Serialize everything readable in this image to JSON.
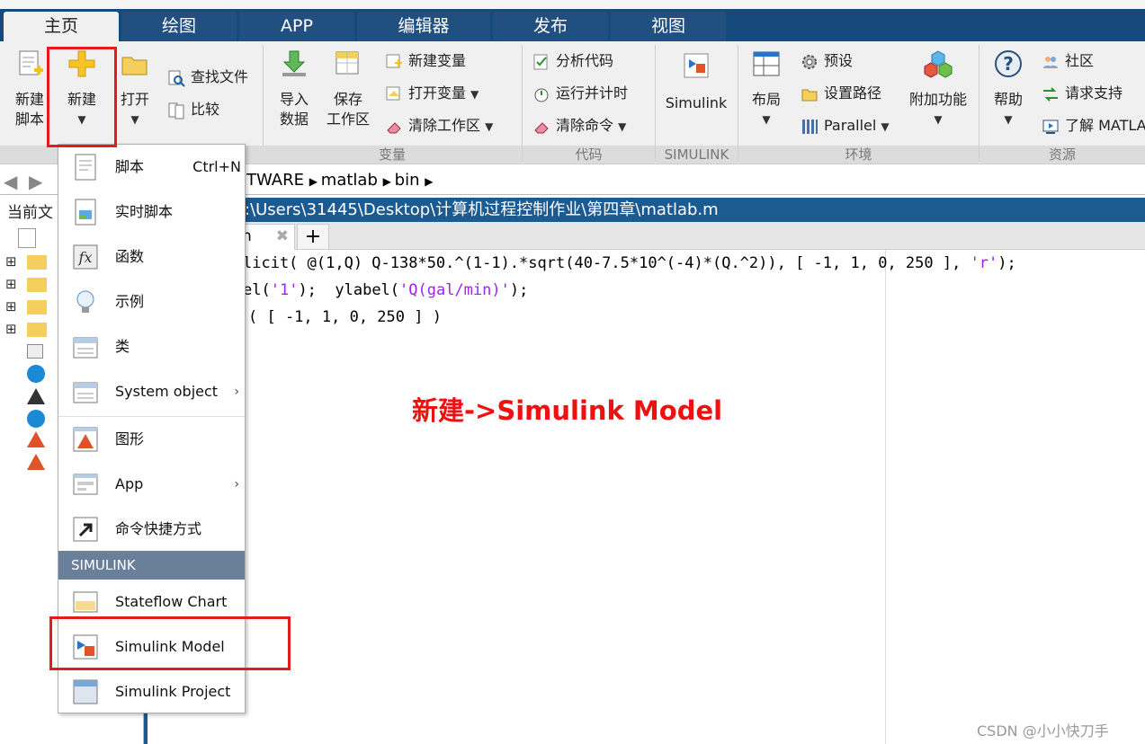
{
  "tabs": [
    "主页",
    "绘图",
    "APP",
    "编辑器",
    "发布",
    "视图"
  ],
  "ribbon": {
    "new_script": "新建\n脚本",
    "new": "新建",
    "open": "打开",
    "find_files": "查找文件",
    "compare": "比较",
    "import_data": "导入\n数据",
    "save_workspace": "保存\n工作区",
    "new_variable": "新建变量",
    "open_variable": "打开变量",
    "clear_workspace": "清除工作区",
    "analyze_code": "分析代码",
    "run_and_time": "运行并计时",
    "clear_commands": "清除命令",
    "simulink": "Simulink",
    "layout": "布局",
    "preferences": "预设",
    "set_path": "设置路径",
    "parallel": "Parallel",
    "addons": "附加功能",
    "help": "帮助",
    "community": "社区",
    "request_support": "请求支持",
    "learn_matlab": "了解 MATLAB",
    "groups": {
      "variable": "变量",
      "code": "代码",
      "simulink": "SIMULINK",
      "environment": "环境",
      "resources": "资源"
    }
  },
  "address": {
    "segments": [
      "TWARE",
      "matlab",
      "bin"
    ]
  },
  "left_panel": {
    "title": "当前文"
  },
  "editor": {
    "path": ":\\Users\\31445\\Desktop\\计算机过程控制作业\\第四章\\matlab.m",
    "tab_label": "n",
    "line1_a": "licit( @(1,Q) Q-138*50.^(1-1).*sqrt(40-7.5*10^(-4)*(Q.^2)), [ -1, 1, 0, 250 ], ",
    "line1_str": "'r'",
    "line1_b": ");",
    "line2_a": "el(",
    "line2_str1": "'1'",
    "line2_b": ");  ylabel(",
    "line2_str2": "'Q(gal/min)'",
    "line2_c": ");",
    "line3": "( [ -1, 1, 0, 250 ] )"
  },
  "menu": {
    "items": [
      {
        "label": "脚本",
        "shortcut": "Ctrl+N"
      },
      {
        "label": "实时脚本"
      },
      {
        "label": "函数"
      },
      {
        "label": "示例"
      },
      {
        "label": "类"
      },
      {
        "label": "System object",
        "sub": "›"
      },
      {
        "label": "图形"
      },
      {
        "label": "App",
        "sub": "›"
      },
      {
        "label": "命令快捷方式"
      }
    ],
    "section": "SIMULINK",
    "sim_items": [
      {
        "label": "Stateflow Chart"
      },
      {
        "label": "Simulink Model"
      },
      {
        "label": "Simulink Project"
      }
    ]
  },
  "annotation": "新建->Simulink Model",
  "watermark": "CSDN @小小快刀手",
  "colors": {
    "tab_bar": "#174a7c",
    "highlight_box": "#e31b1b",
    "annotation": "#ee1111"
  }
}
